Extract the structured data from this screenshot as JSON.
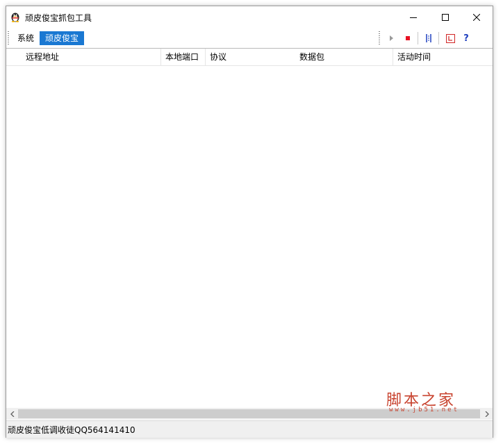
{
  "window": {
    "title": "顽皮俊宝抓包工具"
  },
  "menu": {
    "items": [
      "系统",
      "顽皮俊宝"
    ],
    "active_index": 1
  },
  "toolbar": {
    "icons": [
      "play-icon",
      "stop-icon",
      "columns-icon",
      "clock-icon",
      "help-icon"
    ],
    "help_glyph": "?"
  },
  "table": {
    "columns": [
      "远程地址",
      "本地端口",
      "协议",
      "数据包",
      "活动时间"
    ],
    "rows": []
  },
  "status": {
    "text": "顽皮俊宝低调收徒QQ564141410"
  },
  "watermark": {
    "text": "脚本之家",
    "url": "www.jb51.net"
  },
  "colors": {
    "accent": "#1a78d2",
    "stop": "#e81123",
    "toolbar_blue": "#1e3fbf",
    "clock": "#d32f2f",
    "watermark": "#c8432f"
  }
}
